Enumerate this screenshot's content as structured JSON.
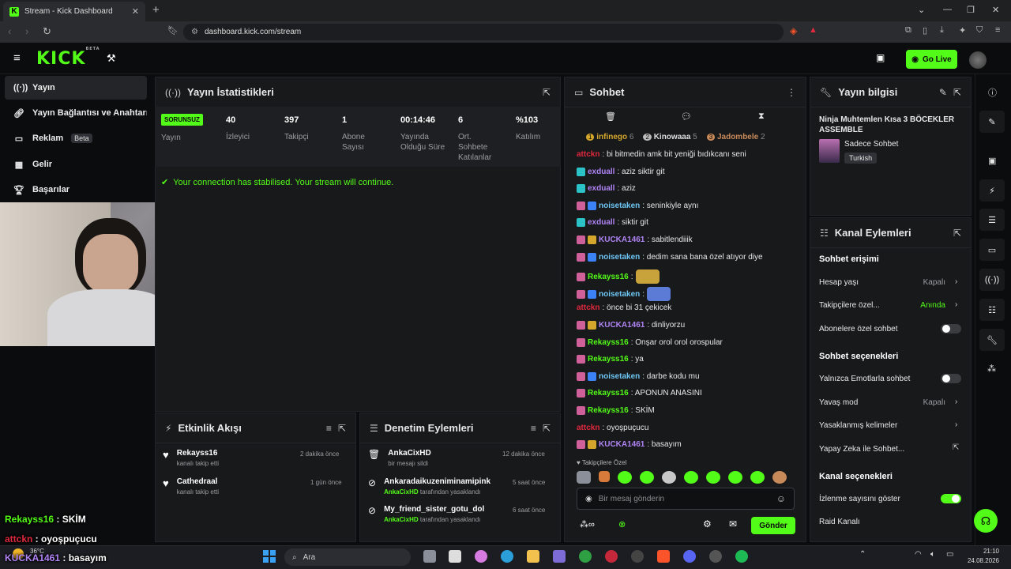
{
  "browser": {
    "tab_title": "Stream - Kick Dashboard",
    "tab_favicon": "K",
    "url": "dashboard.kick.com/stream"
  },
  "header": {
    "logo": "KICK",
    "logo_beta": "BETA",
    "go_live": "Go Live"
  },
  "sidebar": {
    "items": [
      {
        "label": "Yayın",
        "icon": "broadcast-icon"
      },
      {
        "label": "Yayın Bağlantısı ve Anahtarı",
        "icon": "link-icon"
      },
      {
        "label": "Reklam",
        "icon": "ad-icon",
        "badge": "Beta"
      },
      {
        "label": "Gelir",
        "icon": "revenue-icon"
      },
      {
        "label": "Başarılar",
        "icon": "trophy-icon"
      }
    ]
  },
  "stats": {
    "title": "Yayın İstatistikleri",
    "status_badge": "SORUNSUZ",
    "status_label": "Yayın",
    "items": [
      {
        "value": "40",
        "label": "İzleyici"
      },
      {
        "value": "397",
        "label": "Takipçi"
      },
      {
        "value": "1",
        "label": "Abone Sayısı"
      },
      {
        "value": "00:14:46",
        "label": "Yayında Olduğu Süre"
      },
      {
        "value": "6",
        "label": "Ort. Sohbete Katılanlar"
      },
      {
        "value": "%103",
        "label": "Katılım"
      }
    ],
    "connection_msg": "Your connection has stabilised. Your stream will continue."
  },
  "overlay": [
    {
      "user": "Rekayss16",
      "sep": " : ",
      "msg": "SKİM",
      "color": "#53fc18"
    },
    {
      "user": "attckn",
      "sep": " : ",
      "msg": "oyoşpuçucu",
      "color": "#e0283e"
    },
    {
      "user": "KUCKA1461",
      "sep": " : ",
      "msg": "basayım",
      "color": "#b084f5"
    }
  ],
  "activity": {
    "title": "Etkinlik Akışı",
    "items": [
      {
        "name": "Rekayss16",
        "sub": "kanalı takip etti",
        "time": "2 dakika önce"
      },
      {
        "name": "Cathedraal",
        "sub": "kanalı takip etti",
        "time": "1 gün önce"
      }
    ]
  },
  "moderation": {
    "title": "Denetim Eylemleri",
    "items": [
      {
        "name": "AnkaCixHD",
        "sub_prefix": "",
        "sub": "bir mesajı sildi",
        "time": "12 dakika önce",
        "icon": "trash-icon"
      },
      {
        "name": "Ankaradaikuzeniminamipink",
        "sub_prefix": "AnkaCixHD",
        "sub": " tarafından yasaklandı",
        "time": "5 saat önce",
        "icon": "ban-icon"
      },
      {
        "name": "My_friend_sister_gotu_dol",
        "sub_prefix": "AnkaCixHD",
        "sub": " tarafından yasaklandı",
        "time": "6 saat önce",
        "icon": "ban-icon"
      }
    ]
  },
  "chat": {
    "title": "Sohbet",
    "leaderboard": [
      {
        "rank": "1",
        "name": "infinego",
        "count": "6"
      },
      {
        "rank": "2",
        "name": "Kinowaaa",
        "count": "5"
      },
      {
        "rank": "3",
        "name": "Jadombele",
        "count": "2"
      }
    ],
    "messages": [
      {
        "badges": [],
        "user": "attckn",
        "color": "#e0283e",
        "text": ": bi bitmedin amk bit yeniği bıdıkcanı seni"
      },
      {
        "badges": [
          "#2bc3c7"
        ],
        "user": "exduall",
        "color": "#b084f5",
        "text": ": aziz siktir git"
      },
      {
        "badges": [
          "#2bc3c7"
        ],
        "user": "exduall",
        "color": "#b084f5",
        "text": ": aziz"
      },
      {
        "badges": [
          "#d0609a",
          "#3b82f6"
        ],
        "user": "noisetaken",
        "color": "#6ec6f5",
        "text": ": seninkiyle aynı"
      },
      {
        "badges": [
          "#2bc3c7"
        ],
        "user": "exduall",
        "color": "#b084f5",
        "text": ": siktir git"
      },
      {
        "badges": [
          "#d0609a",
          "#d4a72c"
        ],
        "user": "KUCKA1461",
        "color": "#b084f5",
        "text": ": sabitlendiiik"
      },
      {
        "badges": [
          "#d0609a",
          "#3b82f6"
        ],
        "user": "noisetaken",
        "color": "#6ec6f5",
        "text": ": dedim sana bana özel atıyor diye"
      },
      {
        "badges": [
          "#d0609a"
        ],
        "user": "Rekayss16",
        "color": "#53fc18",
        "text": ":",
        "emote": "#c8a23a"
      },
      {
        "badges": [
          "#d0609a",
          "#3b82f6"
        ],
        "user": "noisetaken",
        "color": "#6ec6f5",
        "text": ":",
        "emote": "#5b7bd6"
      },
      {
        "badges": [],
        "user": "attckn",
        "color": "#e0283e",
        "text": ": önce bi 31 çekicek"
      },
      {
        "badges": [
          "#d0609a",
          "#d4a72c"
        ],
        "user": "KUCKA1461",
        "color": "#b084f5",
        "text": ": dinliyorzu"
      },
      {
        "badges": [
          "#d0609a"
        ],
        "user": "Rekayss16",
        "color": "#53fc18",
        "text": ": Onşar orol orol orospular"
      },
      {
        "badges": [
          "#d0609a"
        ],
        "user": "Rekayss16",
        "color": "#53fc18",
        "text": ": ya"
      },
      {
        "badges": [
          "#d0609a",
          "#3b82f6"
        ],
        "user": "noisetaken",
        "color": "#6ec6f5",
        "text": ": darbe kodu mu"
      },
      {
        "badges": [
          "#d0609a"
        ],
        "user": "Rekayss16",
        "color": "#53fc18",
        "text": ": APONUN ANASINI"
      },
      {
        "badges": [
          "#d0609a"
        ],
        "user": "Rekayss16",
        "color": "#53fc18",
        "text": ": SKİM"
      },
      {
        "badges": [],
        "user": "attckn",
        "color": "#e0283e",
        "text": ": oyoşpuçucu"
      },
      {
        "badges": [
          "#d0609a",
          "#d4a72c"
        ],
        "user": "KUCKA1461",
        "color": "#b084f5",
        "text": ": basayım"
      }
    ],
    "followers_only": "Takipçilere Özel",
    "input_placeholder": "Bir mesaj gönderin",
    "send": "Gönder"
  },
  "stream_info": {
    "title": "Yayın bilgisi",
    "stream_title": "Ninja Muhtemlen Kısa 3 BÖCEKLER ASSEMBLE",
    "category": "Sadece Sohbet",
    "language": "Turkish"
  },
  "channel_actions": {
    "title": "Kanal Eylemleri",
    "chat_access": "Sohbet erişimi",
    "account_age": "Hesap yaşı",
    "account_age_val": "Kapalı",
    "followers_only": "Takipçilere özel...",
    "followers_only_val": "Anında",
    "subs_only": "Abonelere özel sohbet",
    "chat_options": "Sohbet seçenekleri",
    "emote_only": "Yalnızca Emotlarla sohbet",
    "slow_mode": "Yavaş mod",
    "slow_mode_val": "Kapalı",
    "banned_words": "Yasaklanmış kelimeler",
    "ai_chat": "Yapay Zeka ile Sohbet...",
    "channel_options": "Kanal seçenekleri",
    "show_viewers": "İzlenme sayısını göster",
    "raid": "Raid Kanalı"
  },
  "taskbar": {
    "weather_temp": "36°C",
    "search": "Ara",
    "time": "21:10",
    "date": "24.08.2026"
  }
}
